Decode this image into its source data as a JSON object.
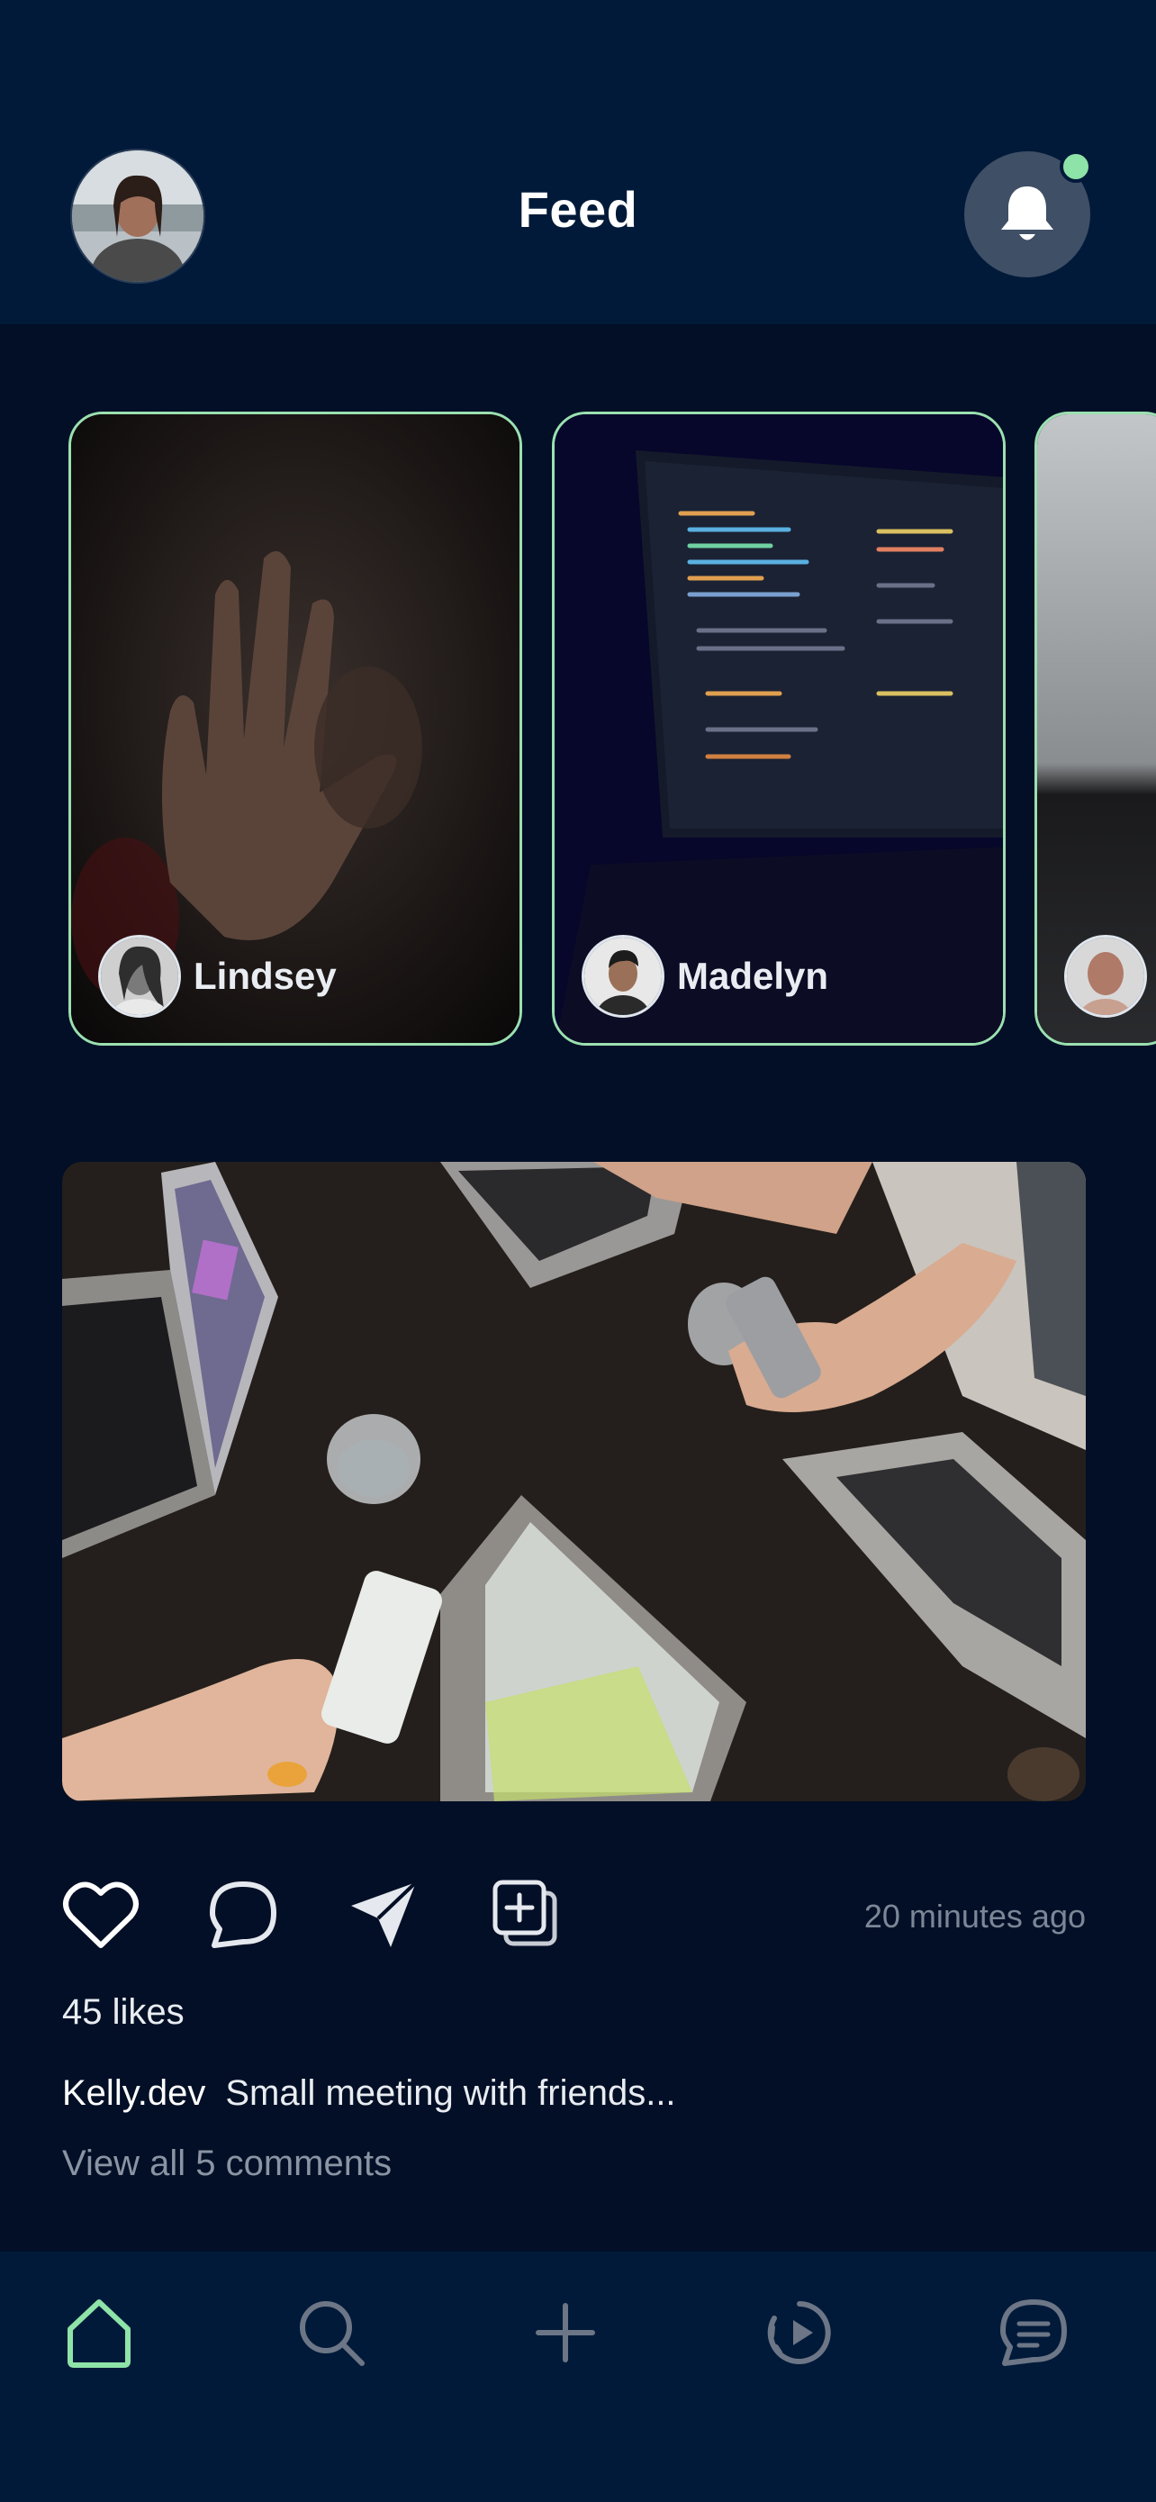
{
  "header": {
    "title": "Feed"
  },
  "stories": [
    {
      "name": "Lindsey"
    },
    {
      "name": "Madelyn"
    },
    {
      "name": ""
    }
  ],
  "post": {
    "time": "20 minutes ago",
    "likes": "45 likes",
    "author": "Kelly.dev",
    "caption": "Small meeting with friends...",
    "comments": "View all 5 comments"
  },
  "icons": {
    "like": "heart-icon",
    "comment": "comment-icon",
    "share": "send-icon",
    "save": "add-collection-icon",
    "notifications": "bell-icon",
    "nav": [
      "home-icon",
      "search-icon",
      "plus-icon",
      "play-circle-icon",
      "chat-icon"
    ]
  },
  "colors": {
    "background": "#020f26",
    "header": "#021a39",
    "accent": "#8ee3a8",
    "muted": "#7b8797"
  }
}
